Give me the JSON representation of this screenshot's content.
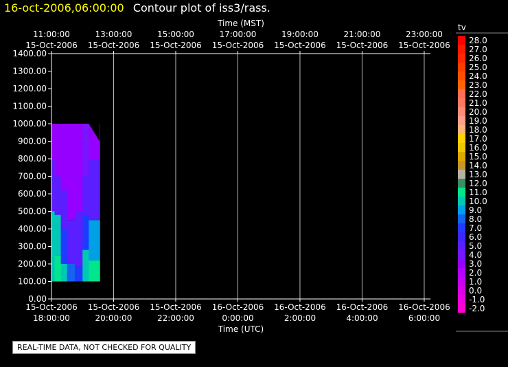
{
  "header": {
    "datetime": "16-oct-2006,06:00:00",
    "title": "Contour plot of iss3/rass."
  },
  "notice": "REAL-TIME DATA, NOT CHECKED FOR QUALITY",
  "chart_data": {
    "type": "contour",
    "title": "Contour plot of iss3/rass.",
    "top_axis": {
      "label": "Time (MST)",
      "ticks": [
        {
          "time": "11:00:00",
          "date": "15-Oct-2006"
        },
        {
          "time": "13:00:00",
          "date": "15-Oct-2006"
        },
        {
          "time": "15:00:00",
          "date": "15-Oct-2006"
        },
        {
          "time": "17:00:00",
          "date": "15-Oct-2006"
        },
        {
          "time": "19:00:00",
          "date": "15-Oct-2006"
        },
        {
          "time": "21:00:00",
          "date": "15-Oct-2006"
        },
        {
          "time": "23:00:00",
          "date": "15-Oct-2006"
        }
      ]
    },
    "bottom_axis": {
      "label": "Time (UTC)",
      "ticks": [
        {
          "date": "15-Oct-2006",
          "time": "18:00:00"
        },
        {
          "date": "15-Oct-2006",
          "time": "20:00:00"
        },
        {
          "date": "15-Oct-2006",
          "time": "22:00:00"
        },
        {
          "date": "16-Oct-2006",
          "time": "0:00:00"
        },
        {
          "date": "16-Oct-2006",
          "time": "2:00:00"
        },
        {
          "date": "16-Oct-2006",
          "time": "4:00:00"
        },
        {
          "date": "16-Oct-2006",
          "time": "6:00:00"
        }
      ],
      "range_hours_utc": [
        18,
        30.2
      ]
    },
    "y_axis": {
      "ticks": [
        "0.00",
        "100.00",
        "200.00",
        "300.00",
        "400.00",
        "500.00",
        "600.00",
        "700.00",
        "800.00",
        "900.00",
        "1000.00",
        "1100.00",
        "1200.00",
        "1300.00",
        "1400.00"
      ],
      "range": [
        0,
        1400
      ]
    },
    "grid": true,
    "legend": {
      "title": "tv",
      "position": "right",
      "levels": [
        {
          "label": "28.0",
          "color": "#ff0000"
        },
        {
          "label": "27.0",
          "color": "#ff1800"
        },
        {
          "label": "26.0",
          "color": "#ff2800"
        },
        {
          "label": "25.0",
          "color": "#ff3c00"
        },
        {
          "label": "24.0",
          "color": "#ff5000"
        },
        {
          "label": "23.0",
          "color": "#ff6400"
        },
        {
          "label": "22.0",
          "color": "#ff7050"
        },
        {
          "label": "21.0",
          "color": "#ff7864"
        },
        {
          "label": "20.0",
          "color": "#ff8c78"
        },
        {
          "label": "19.0",
          "color": "#ffa08c"
        },
        {
          "label": "18.0",
          "color": "#ffb478"
        },
        {
          "label": "17.0",
          "color": "#ffd200"
        },
        {
          "label": "16.0",
          "color": "#f0c800"
        },
        {
          "label": "15.0",
          "color": "#dcaa00"
        },
        {
          "label": "14.0",
          "color": "#c89628"
        },
        {
          "label": "13.0",
          "color": "#b4b4a0"
        },
        {
          "label": "12.0",
          "color": "#3c8c64"
        },
        {
          "label": "11.0",
          "color": "#00e68c"
        },
        {
          "label": "10.0",
          "color": "#00c8b4"
        },
        {
          "label": "9.0",
          "color": "#00a0e6"
        },
        {
          "label": "8.0",
          "color": "#1464f0"
        },
        {
          "label": "7.0",
          "color": "#1e3cff"
        },
        {
          "label": "6.0",
          "color": "#3c28ff"
        },
        {
          "label": "5.0",
          "color": "#5a1eff"
        },
        {
          "label": "4.0",
          "color": "#7814ff"
        },
        {
          "label": "3.0",
          "color": "#9600ff"
        },
        {
          "label": "2.0",
          "color": "#b400ff"
        },
        {
          "label": "1.0",
          "color": "#c800f0"
        },
        {
          "label": "0.0",
          "color": "#dc00e6"
        },
        {
          "label": "-1.0",
          "color": "#ec00dc"
        },
        {
          "label": "-2.0",
          "color": "#ff00d2"
        }
      ]
    },
    "data_extent": {
      "utc_hours": [
        18.0,
        19.55
      ],
      "height": [
        100,
        1000
      ]
    },
    "series": [
      {
        "hour": 18.0,
        "bands": [
          [
            100,
            500,
            10
          ],
          [
            500,
            800,
            5
          ],
          [
            800,
            1000,
            3
          ]
        ]
      },
      {
        "hour": 18.1,
        "bands": [
          [
            100,
            250,
            11
          ],
          [
            250,
            480,
            10
          ],
          [
            480,
            700,
            5
          ],
          [
            700,
            1000,
            3
          ]
        ]
      },
      {
        "hour": 18.3,
        "bands": [
          [
            100,
            200,
            10
          ],
          [
            200,
            400,
            7
          ],
          [
            400,
            620,
            5
          ],
          [
            620,
            1000,
            3
          ]
        ]
      },
      {
        "hour": 18.5,
        "bands": [
          [
            100,
            200,
            8
          ],
          [
            200,
            450,
            5
          ],
          [
            450,
            1000,
            3
          ]
        ]
      },
      {
        "hour": 18.75,
        "bands": [
          [
            100,
            180,
            7
          ],
          [
            180,
            500,
            5
          ],
          [
            500,
            1000,
            3
          ]
        ]
      },
      {
        "hour": 19.0,
        "bands": [
          [
            100,
            280,
            10
          ],
          [
            280,
            480,
            7
          ],
          [
            480,
            700,
            5
          ],
          [
            700,
            1000,
            4
          ]
        ]
      },
      {
        "hour": 19.2,
        "bands": [
          [
            100,
            220,
            11
          ],
          [
            220,
            450,
            9
          ],
          [
            450,
            800,
            5
          ],
          [
            800,
            1000,
            3
          ]
        ]
      },
      {
        "hour": 19.55,
        "bands": [
          [
            100,
            210,
            10
          ],
          [
            210,
            420,
            7
          ],
          [
            420,
            700,
            5
          ],
          [
            700,
            900,
            3
          ]
        ]
      }
    ]
  }
}
